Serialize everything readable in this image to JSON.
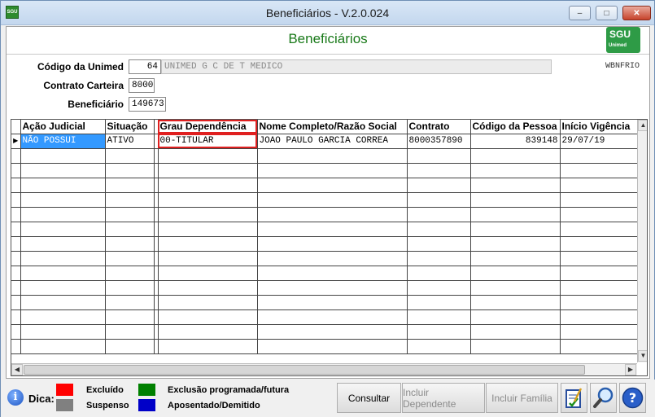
{
  "window": {
    "title": "Beneficiários - V.2.0.024",
    "app_icon_text": "SGU"
  },
  "header": {
    "title": "Beneficiários",
    "logo_text": "SGU",
    "logo_subtext": "Unimed"
  },
  "form": {
    "unimed_label": "Código da Unimed",
    "unimed_code": "64",
    "unimed_name": "UNIMED G C DE T MEDICO",
    "contrato_label": "Contrato Carteira",
    "contrato_value": "8000",
    "beneficiario_label": "Beneficiário",
    "beneficiario_value": "149673",
    "form_code": "WBNFRIO"
  },
  "grid": {
    "columns": [
      "Ação Judicial",
      "Situação",
      "Grau Dependência",
      "Nome Completo/Razão Social",
      "Contrato",
      "Código da Pessoa",
      "Início Vigência"
    ],
    "rows": [
      [
        "NÃO POSSUI",
        "ATIVO",
        "00-TITULAR",
        "JOAO PAULO GARCIA CORREA",
        "8000357890",
        "839148",
        "29/07/19"
      ]
    ],
    "highlight_column": "Grau Dependência"
  },
  "footer": {
    "dica_label": "Dica:",
    "legend": [
      {
        "label": "Excluído",
        "color": "#ff0000"
      },
      {
        "label": "Suspenso",
        "color": "#808080"
      },
      {
        "label": "Exclusão programada/futura",
        "color": "#008000"
      },
      {
        "label": "Aposentado/Demitido",
        "color": "#0000c8"
      }
    ],
    "buttons": {
      "consultar": "Consultar",
      "incluir_dependente": "Incluir Dependente",
      "incluir_familia": "Incluir Família"
    },
    "icons": [
      "edit-icon",
      "search-icon",
      "help-icon"
    ]
  }
}
